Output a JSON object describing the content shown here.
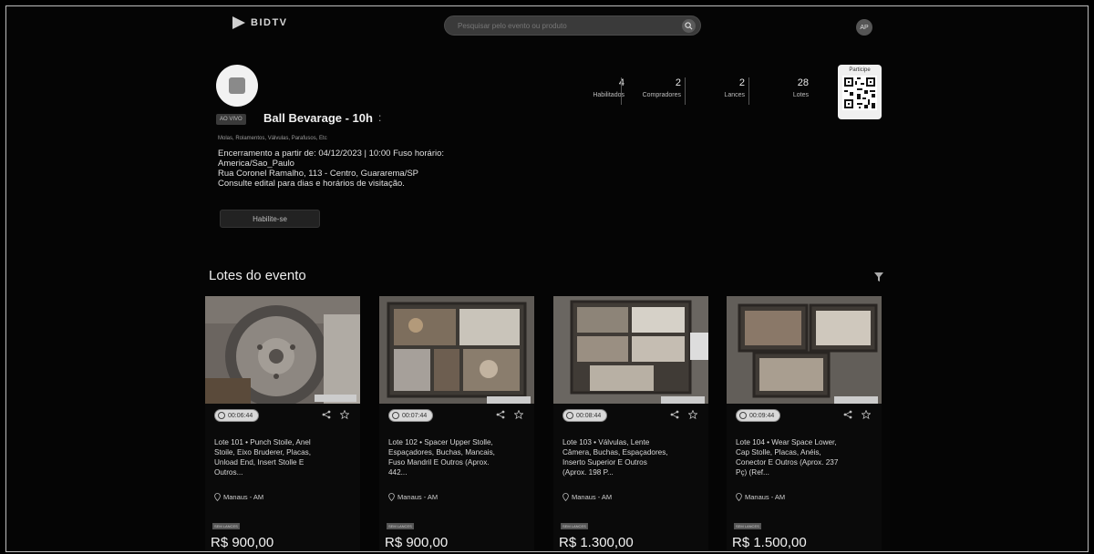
{
  "header": {
    "logo_text": "BIDTV",
    "search_placeholder": "Pesquisar pelo evento ou produto",
    "user_initials": "AP"
  },
  "event": {
    "live_label": "AO VIVO",
    "title": "Ball Bevarage - 10h",
    "title_more": ":",
    "subtitle": "Molas, Rolamentos, Válvulas, Parafusos, Etc",
    "info_lines": [
      "Encerramento a partir de: 04/12/2023 | 10:00 Fuso horário:",
      "America/Sao_Paulo",
      "Rua Coronel Ramalho, 113 - Centro, Guararema/SP",
      "Consulte edital para dias e horários de visitação."
    ],
    "cta_label": "Habilite-se"
  },
  "stats": [
    {
      "value": "4",
      "label": "Habilitados"
    },
    {
      "value": "2",
      "label": "Compradores"
    },
    {
      "value": "2",
      "label": "Lances"
    },
    {
      "value": "28",
      "label": "Lotes"
    }
  ],
  "qr_label": "Participe",
  "section_title": "Lotes do evento",
  "lots": [
    {
      "timer": "00:06:44",
      "title_lines": [
        "Lote 101 • Punch Stoile, Anel",
        "Stoile, Eixo Bruderer, Placas,",
        "Unload End, Insert Stolle E",
        "Outros..."
      ],
      "location": "Manaus - AM",
      "condition": "SEM LANCES",
      "price": "R$ 900,00"
    },
    {
      "timer": "00:07:44",
      "title_lines": [
        "Lote 102 • Spacer Upper Stolle,",
        "Espaçadores, Buchas, Mancais,",
        "Fuso Mandril E Outros (Aprox.",
        "442..."
      ],
      "location": "Manaus - AM",
      "condition": "SEM LANCES",
      "price": "R$ 900,00"
    },
    {
      "timer": "00:08:44",
      "title_lines": [
        "Lote 103 • Válvulas, Lente",
        "Câmera, Buchas, Espaçadores,",
        "Inserto Superior E Outros",
        "(Aprox. 198 P..."
      ],
      "location": "Manaus - AM",
      "condition": "SEM LANCES",
      "price": "R$ 1.300,00"
    },
    {
      "timer": "00:09:44",
      "title_lines": [
        "Lote 104 • Wear Space Lower,",
        "Cap Stolle, Placas, Anéis,",
        "Conector E Outros (Aprox. 237",
        "Pç) (Ref..."
      ],
      "location": "Manaus - AM",
      "condition": "SEM LANCES",
      "price": "R$ 1.500,00"
    }
  ]
}
